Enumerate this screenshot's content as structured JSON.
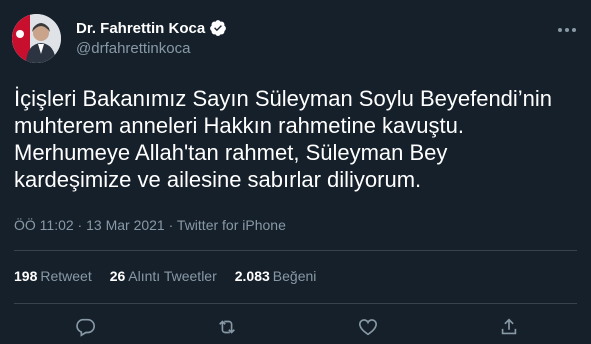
{
  "author": {
    "name": "Dr. Fahrettin Koca",
    "handle": "@drfahrettinkoca",
    "verified_icon": "verified-badge-icon",
    "avatar_icon": "profile-avatar"
  },
  "tweet": {
    "lines": [
      "İçişleri Bakanımız Sayın Süleyman Soylu Beyefendi’nin",
      "muhterem anneleri Hakkın rahmetine kavuştu.",
      "Merhumeye Allah'tan rahmet, Süleyman Bey",
      "kardeşimize ve ailesine sabırlar diliyorum."
    ],
    "timestamp": "ÖÖ 11:02 · 13 Mar 2021",
    "source": "Twitter for iPhone"
  },
  "stats": {
    "retweets": {
      "count": "198",
      "label": "Retweet"
    },
    "quotes": {
      "count": "26",
      "label": "Alıntı Tweetler"
    },
    "likes": {
      "count": "2.083",
      "label": "Beğeni"
    }
  },
  "actions": {
    "icons": [
      "reply-icon",
      "retweet-icon",
      "like-icon",
      "share-icon"
    ]
  },
  "colors": {
    "background": "#15202b",
    "secondary_text": "#8899a6",
    "divider": "#38444d",
    "verified": "#ffffff"
  }
}
